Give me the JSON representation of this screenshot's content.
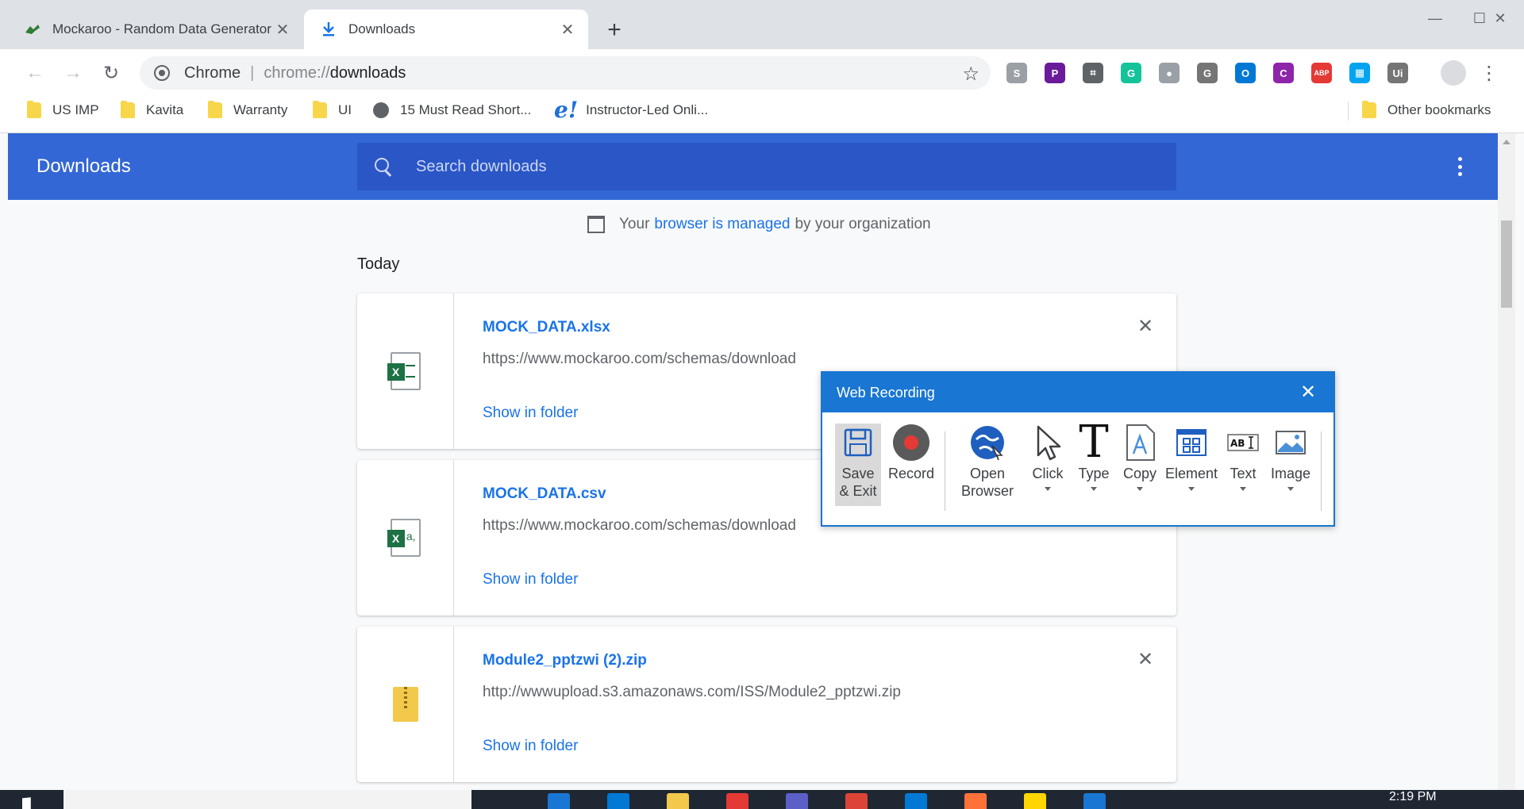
{
  "browser": {
    "tabs": [
      {
        "title": "Mockaroo - Random Data Generator",
        "active": false
      },
      {
        "title": "Downloads",
        "active": true
      }
    ],
    "new_tab_glyph": "+",
    "window_controls": {
      "minimize": "—",
      "maximize": "☐",
      "close": "✕"
    },
    "omnibox": {
      "origin_label": "Chrome",
      "url_scheme": "chrome://",
      "url_host": "downloads"
    },
    "nav": {
      "back": "←",
      "forward": "→",
      "reload": "↻",
      "star": "☆"
    }
  },
  "bookmarks": [
    {
      "label": "US IMP",
      "icon": "folder-icon"
    },
    {
      "label": "Kavita",
      "icon": "folder-icon"
    },
    {
      "label": "Warranty",
      "icon": "folder-icon"
    },
    {
      "label": "UI",
      "icon": "folder-icon"
    },
    {
      "label": "15 Must Read Short...",
      "icon": "globe-icon"
    },
    {
      "label": "Instructor-Led Onli...",
      "icon": "e-icon"
    },
    {
      "label": "Other bookmarks",
      "icon": "folder-icon"
    }
  ],
  "extensions": [
    {
      "name": "skype-icon",
      "glyph": "S",
      "color": "#9aa0a6"
    },
    {
      "name": "pro-icon",
      "glyph": "P",
      "color": "#6a1b9a"
    },
    {
      "name": "screenshot-icon",
      "glyph": "⌗",
      "color": "#5f6368"
    },
    {
      "name": "grammarly-icon",
      "glyph": "G",
      "color": "#15c39a"
    },
    {
      "name": "circle-icon",
      "glyph": "●",
      "color": "#9aa0a6"
    },
    {
      "name": "g-icon",
      "glyph": "G",
      "color": "#757575"
    },
    {
      "name": "o-icon",
      "glyph": "O",
      "color": "#0078d4"
    },
    {
      "name": "pink-icon",
      "glyph": "C",
      "color": "#8e24aa"
    },
    {
      "name": "adblock-icon",
      "glyph": "ABP",
      "color": "#e53935"
    },
    {
      "name": "windows-icon",
      "glyph": "▦",
      "color": "#00a4ef"
    },
    {
      "name": "uipath-icon",
      "glyph": "Ui",
      "color": "#757575"
    }
  ],
  "downloads_page": {
    "title": "Downloads",
    "search_placeholder": "Search downloads",
    "managed_prefix": "Your",
    "managed_link": "browser is managed",
    "managed_suffix": "by your organization",
    "section": "Today",
    "show_in_folder": "Show in folder",
    "close_glyph": "✕",
    "items": [
      {
        "name": "MOCK_DATA.xlsx",
        "url": "https://www.mockaroo.com/schemas/download",
        "type": "xlsx"
      },
      {
        "name": "MOCK_DATA.csv",
        "url": "https://www.mockaroo.com/schemas/download",
        "type": "csv"
      },
      {
        "name": "Module2_pptzwi (2).zip",
        "url": "http://wwwupload.s3.amazonaws.com/ISS/Module2_pptzwi.zip",
        "type": "zip"
      }
    ]
  },
  "web_recording": {
    "title": "Web Recording",
    "close_glyph": "✕",
    "tools": [
      {
        "label": "Save\n& Exit",
        "line1": "Save",
        "line2": "& Exit"
      },
      {
        "label": "Record"
      },
      {
        "line1": "Open",
        "line2": "Browser"
      },
      {
        "label": "Click"
      },
      {
        "label": "Type"
      },
      {
        "label": "Copy"
      },
      {
        "label": "Element"
      },
      {
        "label": "Text"
      },
      {
        "label": "Image"
      }
    ]
  },
  "taskbar": {
    "clock": "2:19 PM"
  },
  "colors": {
    "header_blue": "#3367d6",
    "link_blue": "#1a73e8",
    "recorder_blue": "#1976d2",
    "record_red": "#e53935"
  }
}
